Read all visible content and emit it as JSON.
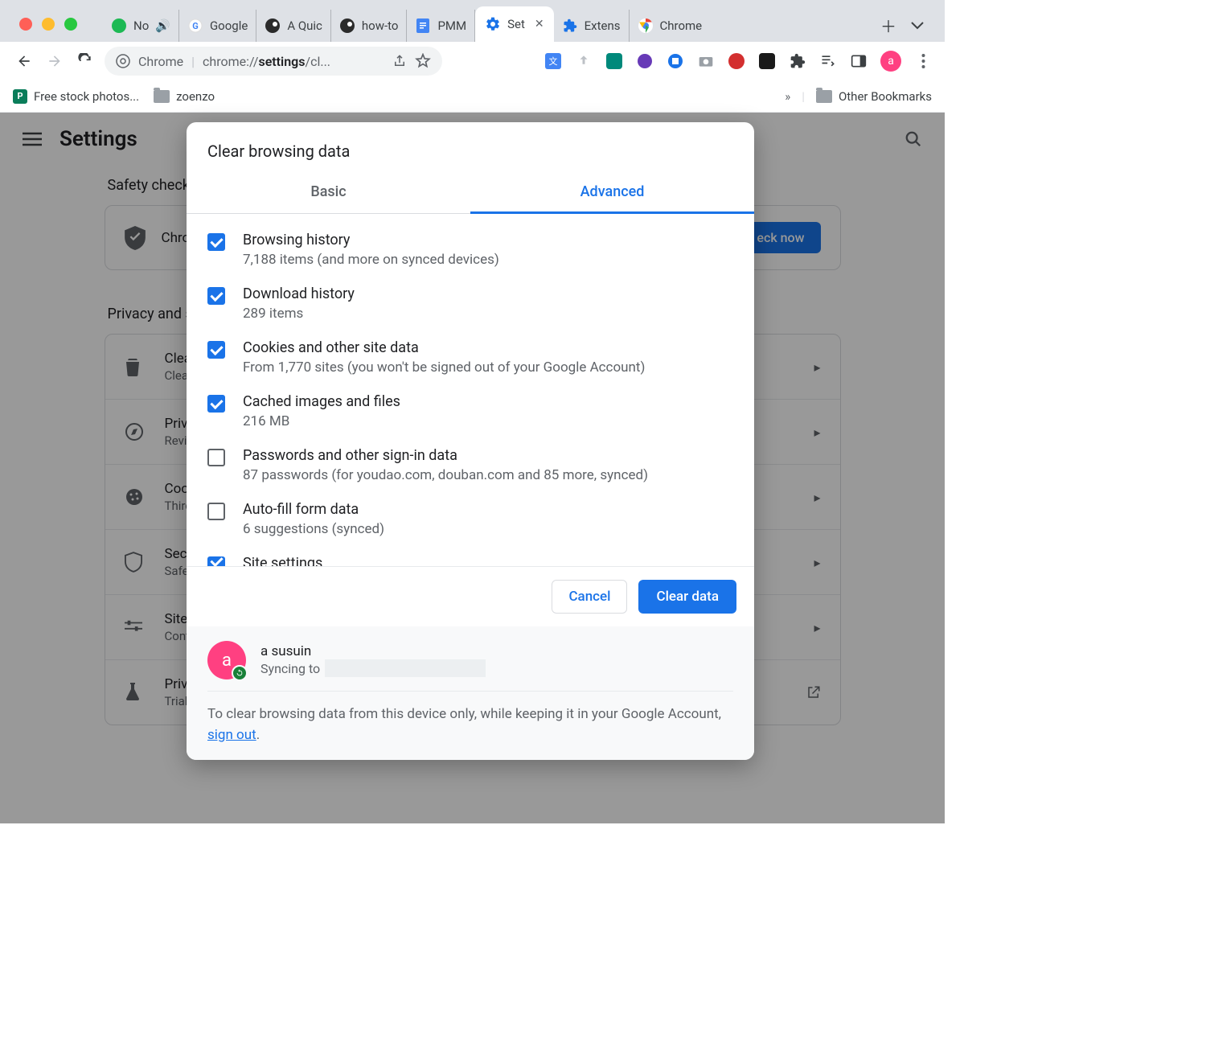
{
  "tabs": [
    {
      "title": "No"
    },
    {
      "title": ""
    },
    {
      "title": "Google"
    },
    {
      "title": "A Quic"
    },
    {
      "title": "how-to"
    },
    {
      "title": "PMM"
    },
    {
      "title": "Set",
      "active": true
    },
    {
      "title": "Extens"
    },
    {
      "title": "Chrome"
    }
  ],
  "omnibox": {
    "site_label": "Chrome",
    "url_prefix": "chrome://",
    "url_bold": "settings",
    "url_suffix": "/cl..."
  },
  "bookmarks": {
    "item1": "Free stock photos...",
    "item2": "zoenzo",
    "other": "Other Bookmarks"
  },
  "settings": {
    "title": "Settings",
    "safety_label": "Safety check",
    "safety_text": "Chro",
    "check_now": "eck now",
    "privacy_label": "Privacy and s",
    "rows": [
      {
        "t1": "Clear",
        "t2": "Clear"
      },
      {
        "t1": "Priva",
        "t2": "Revi"
      },
      {
        "t1": "Cook",
        "t2": "Third"
      },
      {
        "t1": "Secu",
        "t2": "Safe"
      },
      {
        "t1": "Site s",
        "t2": "Cont"
      },
      {
        "t1": "Priva",
        "t2": "Trial"
      }
    ]
  },
  "modal": {
    "title": "Clear browsing data",
    "tab_basic": "Basic",
    "tab_advanced": "Advanced",
    "items": [
      {
        "checked": true,
        "title": "Browsing history",
        "sub": "7,188 items (and more on synced devices)"
      },
      {
        "checked": true,
        "title": "Download history",
        "sub": "289 items"
      },
      {
        "checked": true,
        "title": "Cookies and other site data",
        "sub": "From 1,770 sites (you won't be signed out of your Google Account)"
      },
      {
        "checked": true,
        "title": "Cached images and files",
        "sub": "216 MB"
      },
      {
        "checked": false,
        "title": "Passwords and other sign-in data",
        "sub": "87 passwords (for youdao.com, douban.com and 85 more, synced)"
      },
      {
        "checked": false,
        "title": "Auto-fill form data",
        "sub": "6 suggestions (synced)"
      },
      {
        "checked": true,
        "title": "Site settings",
        "sub": ""
      }
    ],
    "cancel": "Cancel",
    "clear": "Clear data",
    "user_name": "a susuin",
    "user_avatar": "a",
    "syncing_to": "Syncing to",
    "signout_pre": "To clear browsing data from this device only, while keeping it in your Google Account, ",
    "signout_link": "sign out",
    "signout_post": "."
  }
}
